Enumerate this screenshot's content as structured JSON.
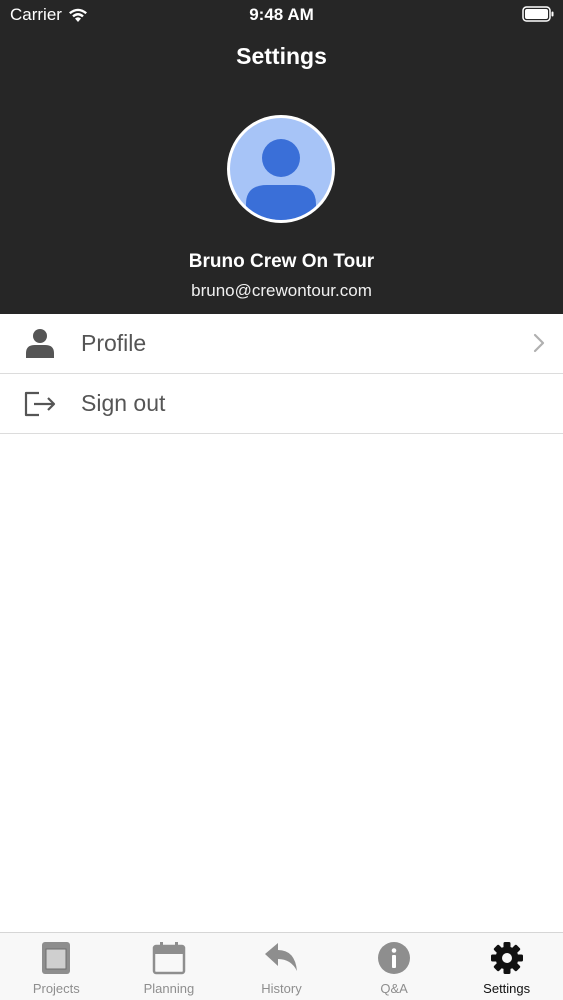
{
  "status_bar": {
    "carrier": "Carrier",
    "time": "9:48 AM"
  },
  "header": {
    "title": "Settings"
  },
  "user": {
    "name": "Bruno Crew On Tour",
    "email": "bruno@crewontour.com"
  },
  "menu": [
    {
      "label": "Profile",
      "icon": "person-icon"
    },
    {
      "label": "Sign out",
      "icon": "sign-out-icon"
    }
  ],
  "tabs": [
    {
      "label": "Projects",
      "icon": "projects-icon"
    },
    {
      "label": "Planning",
      "icon": "calendar-icon"
    },
    {
      "label": "History",
      "icon": "history-icon"
    },
    {
      "label": "Q&A",
      "icon": "info-icon"
    },
    {
      "label": "Settings",
      "icon": "gear-icon"
    }
  ],
  "colors": {
    "header_bg": "#262626",
    "avatar_bg": "#a7c4f7",
    "avatar_fg": "#3a6fd8",
    "active_tab": "#111111",
    "inactive_tab": "#8e8e8e"
  }
}
